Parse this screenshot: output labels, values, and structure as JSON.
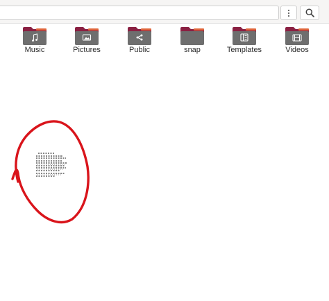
{
  "colors": {
    "folder_back": "#8a2042",
    "folder_tab": "#e0663b",
    "folder_front": "#6e6e6e",
    "annotation_red": "#d9141b"
  },
  "toolbar": {
    "menu_icon": "vertical-dots-icon",
    "search_icon": "search-icon"
  },
  "folders": [
    {
      "label": "Music",
      "icon": "music-note-icon"
    },
    {
      "label": "Pictures",
      "icon": "picture-icon"
    },
    {
      "label": "Public",
      "icon": "share-icon"
    },
    {
      "label": "snap",
      "icon": "none"
    },
    {
      "label": "Templates",
      "icon": "template-icon"
    },
    {
      "label": "Videos",
      "icon": "film-icon"
    }
  ],
  "annotation": {
    "type": "red-circle-scribble"
  }
}
